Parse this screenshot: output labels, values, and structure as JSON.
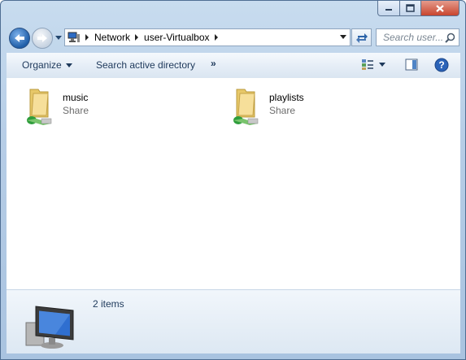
{
  "window": {
    "buttons": {
      "minimize": "minimize",
      "maximize": "maximize",
      "close": "close"
    }
  },
  "address": {
    "breadcrumbs": [
      "Network",
      "user-Virtualbox"
    ],
    "search_placeholder": "Search user..."
  },
  "toolbar": {
    "organize_label": "Organize",
    "search_ad_label": "Search active directory",
    "more_label": "»"
  },
  "items": [
    {
      "name": "music",
      "type": "Share"
    },
    {
      "name": "playlists",
      "type": "Share"
    }
  ],
  "details": {
    "count_text": "2 items"
  },
  "colors": {
    "accent": "#1e395b",
    "frame": "#b6cde6",
    "close": "#c8452e"
  }
}
